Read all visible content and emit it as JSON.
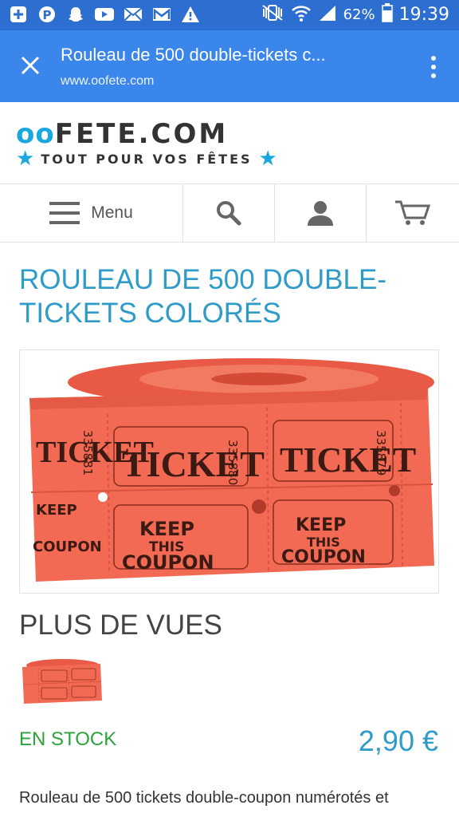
{
  "status_bar": {
    "battery_percent": "62%",
    "time": "19:39",
    "icons": [
      "plus-box-icon",
      "pinterest-icon",
      "snapchat-icon",
      "youtube-icon",
      "mail-icon",
      "gmail-icon",
      "warning-icon",
      "mute-vibrate-icon",
      "wifi-icon",
      "signal-icon",
      "battery-icon"
    ]
  },
  "tab": {
    "title": "Rouleau de 500 double-tickets c...",
    "url": "www.oofete.com"
  },
  "logo": {
    "oo": "oo",
    "name": "FETE.COM",
    "tagline": "TOUT POUR VOS FÊTES"
  },
  "nav": {
    "menu_label": "Menu"
  },
  "product": {
    "title": "ROULEAU DE 500 DOUBLE-TICKETS COLORÉS",
    "more_views": "PLUS DE VUES",
    "stock": "EN STOCK",
    "price": "2,90 €",
    "description": "Rouleau de 500 tickets double-coupon numérotés et"
  },
  "tickets": {
    "ticket_word": "TICKET",
    "keep": "KEEP",
    "this": "THIS",
    "coupon": "COUPON",
    "num1": "335881",
    "num2": "335880",
    "num3": "335879"
  },
  "colors": {
    "status_bar": "#2c6fd1",
    "tab_bar": "#3b86ea",
    "accent": "#2f9bc9",
    "stock": "#2ea23c",
    "ticket": "#f0664f"
  }
}
